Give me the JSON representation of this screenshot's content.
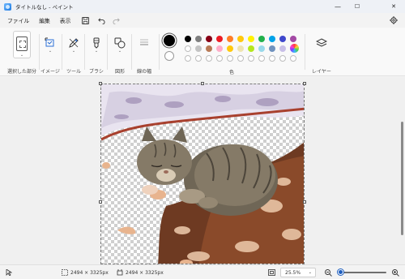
{
  "window": {
    "title": "タイトルなし - ペイント",
    "minimize": "—",
    "maximize": "☐",
    "close": "✕"
  },
  "menu": {
    "items": [
      "ファイル",
      "編集",
      "表示"
    ],
    "icons": [
      "save-icon",
      "undo-icon",
      "redo-icon",
      "gear-icon"
    ]
  },
  "toolbar": {
    "selection_label": "選択した部分",
    "image_label": "イメージ",
    "tools_label": "ツール",
    "brush_label": "ブラシ",
    "shapes_label": "図形",
    "linewidth_label": "線の幅",
    "colors_label": "色",
    "layers_label": "レイヤー",
    "primary_color": "#000000",
    "secondary_color": "#ffffff",
    "palette_row1": [
      "#000000",
      "#7f7f7f",
      "#880015",
      "#ed1c24",
      "#ff7f27",
      "#ffc90e",
      "#fff200",
      "#22b14c",
      "#00a2e8",
      "#3f48cc",
      "#a349a4"
    ],
    "palette_row2": [
      "#ffffff",
      "#c3c3c3",
      "#b97a57",
      "#ffaec9",
      "#ffc90e",
      "#efe4b0",
      "#b5e61d",
      "#99d9ea",
      "#7092be",
      "#c8bfe7",
      "#e6e6e6"
    ],
    "palette_row3_count": 11
  },
  "statusbar": {
    "selection_size": "2494 × 3325px",
    "canvas_size": "2494 × 3325px",
    "zoom": "25.5%",
    "zoom_level": 0.02
  }
}
